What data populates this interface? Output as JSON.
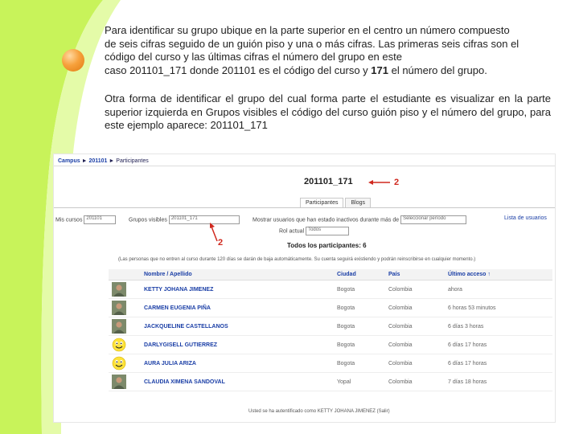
{
  "instructions": {
    "paragraph1_line1": "Para identificar su grupo ubique en la parte superior en el centro un número compuesto",
    "paragraph1_line2": "de seis cifras seguido de un guión piso y una o más cifras. Las primeras seis cifras son el",
    "paragraph1_line3": "código del curso y las últimas cifras el número del grupo en este",
    "paragraph1_line4_prefix": "caso 201101_171 donde 201101 es el código del curso y ",
    "paragraph1_line4_bold": "171",
    "paragraph1_line4_suffix": " el número del grupo.",
    "paragraph2": "Otra forma de identificar el grupo del cual forma parte el estudiante es visualizar en la parte superior izquierda en Grupos visibles el código del curso guión piso y el número del grupo, para este ejemplo aparece: 201101_171"
  },
  "colors": {
    "background_green": "#c8f35a",
    "bullet_orange": "#f39a34",
    "link_blue": "#1a3ea6",
    "annotation_red": "#d0281e"
  },
  "screenshot": {
    "breadcrumb": [
      "Campus",
      "201101",
      "Participantes"
    ],
    "breadcrumb_separator": "►",
    "group_title": "201101_171",
    "annotation_number": "2",
    "tabs": [
      "Participantes",
      "Blogs"
    ],
    "filters": {
      "my_courses_label": "Mis cursos",
      "my_courses_value": "201101",
      "visible_groups_label": "Grupos visibles",
      "visible_groups_value": "201101_171",
      "inactive_label": "Mostrar usuarios que han estado inactivos durante más de",
      "inactive_value": "Seleccionar período",
      "list_label": "Lista de usuarios"
    },
    "role_label": "Rol actual",
    "role_value": "Todos",
    "all_participants": "Todos los participantes: 6",
    "note": "(Las personas que no entren al curso durante 120 días se darán de baja automáticamente. Su cuenta seguirá existiendo y podrán reinscribirse en cualquier momento.)",
    "columns": [
      "Nombre / Apellido",
      "Ciudad",
      "País",
      "Último acceso ↑"
    ],
    "rows": [
      {
        "avatar_icon": "photo-icon",
        "name": "KETTY JOHANA JIMENEZ",
        "city": "Bogota",
        "country": "Colombia",
        "last_access": "ahora"
      },
      {
        "avatar_icon": "photo-icon",
        "name": "CARMEN EUGENIA PIÑA",
        "city": "Bogota",
        "country": "Colombia",
        "last_access": "6 horas 53 minutos"
      },
      {
        "avatar_icon": "photo-icon",
        "name": "JACKQUELINE CASTELLANOS",
        "city": "Bogota",
        "country": "Colombia",
        "last_access": "6 días 3 horas"
      },
      {
        "avatar_icon": "smiley-icon",
        "name": "DARLYGISELL GUTIERREZ",
        "city": "Bogota",
        "country": "Colombia",
        "last_access": "6 días 17 horas"
      },
      {
        "avatar_icon": "smiley-icon",
        "name": "AURA JULIA ARIZA",
        "city": "Bogota",
        "country": "Colombia",
        "last_access": "6 días 17 horas"
      },
      {
        "avatar_icon": "photo-icon",
        "name": "CLAUDIA XIMENA SANDOVAL",
        "city": "Yopal",
        "country": "Colombia",
        "last_access": "7 días 18 horas"
      }
    ],
    "footer": "Usted se ha autentificado como KETTY JOHANA JIMENEZ (Salir)"
  }
}
